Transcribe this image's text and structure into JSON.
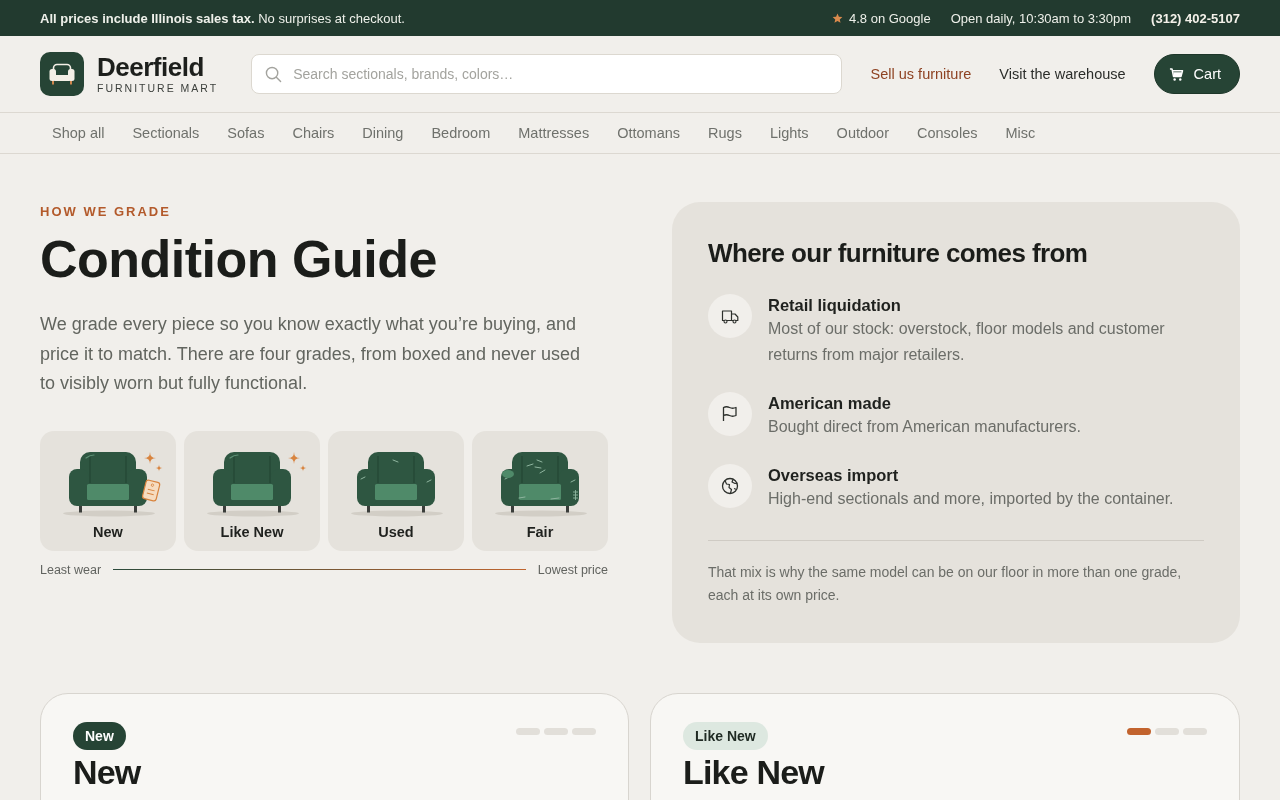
{
  "announcement": {
    "text": "**All prices include Illinois sales tax.** No surprises at checkout.",
    "rating": "4.8 on Google",
    "hours": "Open daily, 10:30am to 3:30pm",
    "phone": "(312) 402-5107"
  },
  "header": {
    "brand": {
      "name": "Deerfield",
      "tagline": "FURNITURE MART"
    },
    "search": {
      "placeholder": "Search sectionals, brands, colors…"
    },
    "links": [
      {
        "label": "Sell us furniture",
        "kind": "accent"
      },
      {
        "label": "Visit the warehouse",
        "kind": "plain"
      }
    ],
    "cart": {
      "label": "Cart"
    }
  },
  "nav": [
    "Shop all",
    "Sectionals",
    "Sofas",
    "Chairs",
    "Dining",
    "Bedroom",
    "Mattresses",
    "Ottomans",
    "Rugs",
    "Lights",
    "Outdoor",
    "Consoles",
    "Misc"
  ],
  "guide": {
    "eyebrow": "HOW WE GRADE",
    "title": "Condition Guide",
    "intro": "We grade every piece so you know exactly what you’re buying, and price it to match. There are four grades, from boxed and never used to visibly worn but fully functional.",
    "grades": [
      {
        "label": "New",
        "kind": "new"
      },
      {
        "label": "Like New",
        "kind": "like_new"
      },
      {
        "label": "Used",
        "kind": "used"
      },
      {
        "label": "Fair",
        "kind": "fair"
      }
    ],
    "scale": {
      "start": "Least wear",
      "end": "Lowest price"
    }
  },
  "sources": {
    "title": "Where our furniture comes from",
    "items": [
      {
        "kind": "retail",
        "title": "Retail liquidation",
        "text": "Most of our stock: overstock, floor models and customer returns from major retailers."
      },
      {
        "kind": "domestic",
        "title": "American made",
        "text": "Bought direct from American manufacturers."
      },
      {
        "kind": "overseas",
        "title": "Overseas import",
        "text": "High-end sectionals and more, imported by the container."
      }
    ],
    "note": "That mix is why the same model can be on our floor in more than one grade, each at its own price."
  },
  "cards": [
    {
      "badge": {
        "label": "New",
        "kind": "solid"
      },
      "wear_marks": [
        {
          "on": false
        },
        {
          "on": false
        },
        {
          "on": false
        }
      ],
      "title": "New"
    },
    {
      "badge": {
        "label": "Like New",
        "kind": "soft"
      },
      "wear_marks": [
        {
          "on": true
        },
        {
          "on": false
        },
        {
          "on": false
        }
      ],
      "title": "Like New"
    }
  ]
}
